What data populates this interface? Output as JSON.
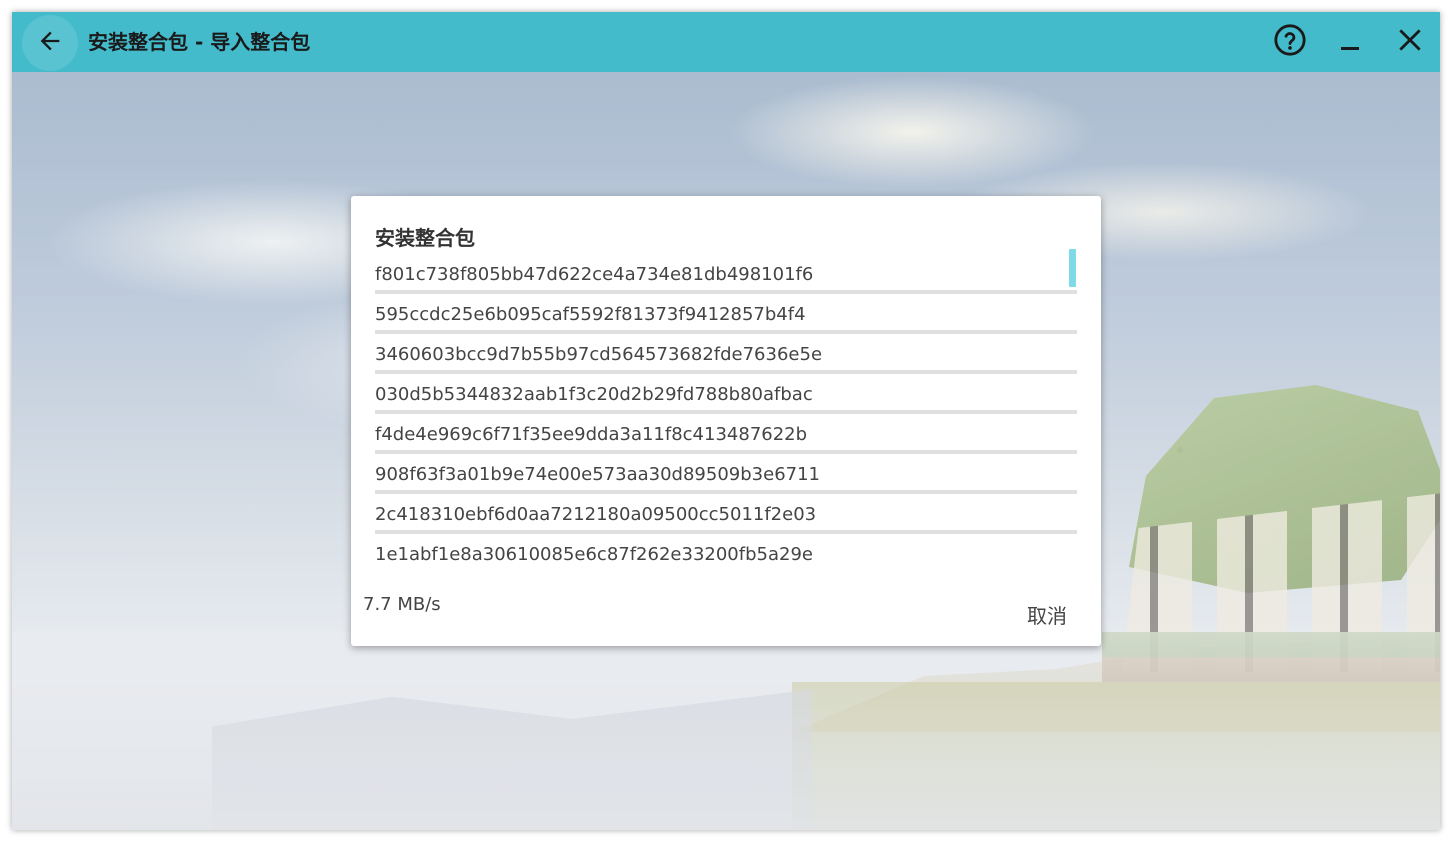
{
  "titlebar": {
    "title": "安装整合包 - 导入整合包",
    "accent_color": "#43bbcb",
    "icons": [
      "arrow-left-icon",
      "help-circle-icon",
      "minimize-icon",
      "close-icon"
    ]
  },
  "dialog": {
    "title": "安装整合包",
    "tasks": [
      "f801c738f805bb47d622ce4a734e81db498101f6",
      "595ccdc25e6b095caf5592f81373f9412857b4f4",
      "3460603bcc9d7b55b97cd564573682fde7636e5e",
      "030d5b5344832aab1f3c20d2b29fd788b80afbac",
      "f4de4e969c6f71f35ee9dda3a11f8c413487622b",
      "908f63f3a01b9e74e00e573aa30d89509b3e6711",
      "2c418310ebf6d0aa7212180a09500cc5011f2e03",
      "1e1abf1e8a30610085e6c87f262e33200fb5a29e"
    ],
    "speed": "7.7 MB/s",
    "cancel_label": "取消",
    "scrollbar_color": "#7fd9e6"
  }
}
